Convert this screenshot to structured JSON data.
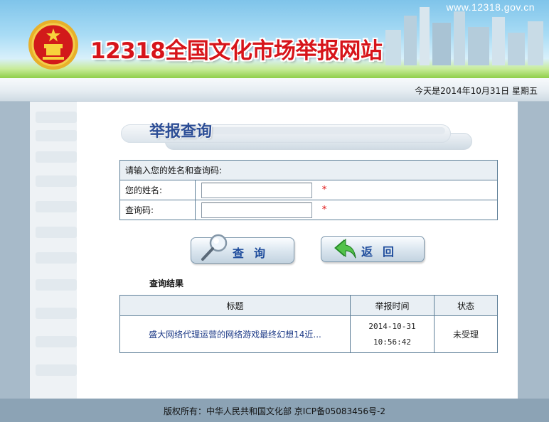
{
  "header": {
    "site_url": "www.12318.gov.cn",
    "site_title": "12318全国文化市场举报网站",
    "emblem_icon": "national-emblem-icon"
  },
  "date_bar": {
    "text": "今天是2014年10月31日 星期五"
  },
  "main": {
    "title": "举报查询",
    "form": {
      "intro": "请输入您的姓名和查询码:",
      "name_label": "您的姓名:",
      "name_value": "",
      "code_label": "查询码:",
      "code_value": "",
      "required_mark": "*"
    },
    "buttons": {
      "query_label": "查询",
      "back_label": "返回",
      "query_icon": "magnifier-icon",
      "back_icon": "return-arrow-icon"
    },
    "results": {
      "label": "查询结果",
      "columns": [
        "标题",
        "举报时间",
        "状态"
      ],
      "rows": [
        {
          "title": "盛大网络代理运营的网络游戏最终幻想14近...",
          "date": "2014-10-31",
          "time": "10:56:42",
          "status": "未受理"
        }
      ]
    }
  },
  "footer": {
    "text": "版权所有：中华人民共和国文化部    京ICP备05083456号-2"
  },
  "colors": {
    "title_red": "#d7141a",
    "heading_blue": "#2d4e96",
    "link_blue": "#1f3c88",
    "frame": "#a7bac9"
  }
}
